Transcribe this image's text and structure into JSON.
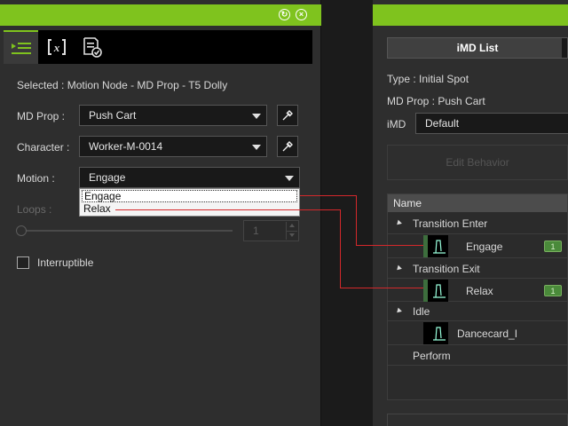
{
  "left": {
    "selected_text": "Selected : Motion Node - MD Prop - T5 Dolly",
    "tabs": [
      {
        "icon": "motion-list-icon"
      },
      {
        "icon": "variable-x-icon"
      },
      {
        "icon": "checklist-icon"
      }
    ],
    "md_prop": {
      "label": "MD Prop :",
      "value": "Push Cart"
    },
    "character": {
      "label": "Character :",
      "value": "Worker-M-0014"
    },
    "motion": {
      "label": "Motion :",
      "value": "Engage",
      "options": [
        "Engage",
        "Relax"
      ]
    },
    "loops": {
      "label": "Loops :",
      "value": "1"
    },
    "interruptible": {
      "label": "Interruptible",
      "checked": false
    }
  },
  "right": {
    "list_header": "iMD List",
    "type_text": "Type : Initial Spot",
    "md_prop_text": "MD Prop :  Push Cart",
    "imd_label": "iMD",
    "imd_value": "Default",
    "edit_behavior": "Edit Behavior",
    "column_name": "Name",
    "tree": [
      {
        "kind": "group",
        "label": "Transition Enter"
      },
      {
        "kind": "item",
        "label": "Engage",
        "badge": "1"
      },
      {
        "kind": "group",
        "label": "Transition Exit"
      },
      {
        "kind": "item",
        "label": "Relax",
        "badge": "1"
      },
      {
        "kind": "group",
        "label": "Idle"
      },
      {
        "kind": "item",
        "label": "Dancecard_I"
      },
      {
        "kind": "leaf",
        "label": "Perform"
      }
    ]
  },
  "colors": {
    "accent": "#7fc31e",
    "connector": "#d4282b",
    "badge": "#4a8a3a"
  }
}
